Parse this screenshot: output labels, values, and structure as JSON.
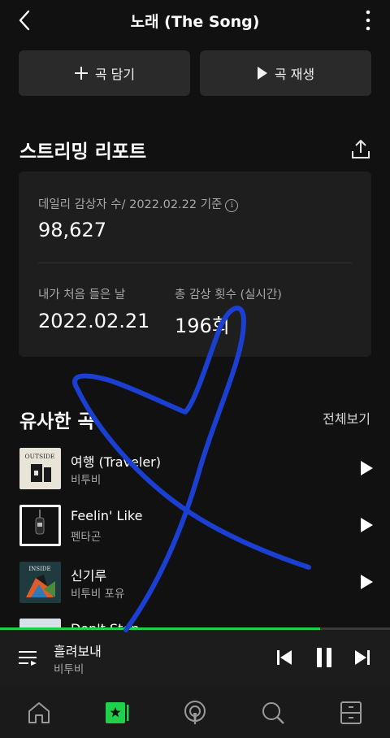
{
  "header": {
    "title": "노래 (The Song)"
  },
  "actions": {
    "add_label": "곡 담기",
    "play_label": "곡 재생"
  },
  "report": {
    "title": "스트리밍 리포트",
    "daily_listeners_label": "데일리 감상자 수/ 2022.02.22 기준",
    "daily_listeners_value": "98,627",
    "first_listen_label": "내가 처음 들은 날",
    "first_listen_value": "2022.02.21",
    "total_plays_label": "총 감상 횟수 (실시간)",
    "total_plays_value": "196회"
  },
  "similar": {
    "title": "유사한 곡",
    "see_all": "전체보기",
    "songs": [
      {
        "title": "여행 (Traveler)",
        "artist": "비투비",
        "cover_text": "OUTSIDE"
      },
      {
        "title": "Feelin' Like",
        "artist": "펜타곤"
      },
      {
        "title": "신기루",
        "artist": "비투비 포유",
        "cover_text": "INSIDE"
      },
      {
        "title": "Don't Stop"
      }
    ]
  },
  "player": {
    "title": "흘려보내",
    "artist": "비투비",
    "progress": 0.82
  },
  "colors": {
    "accent": "#1ed04a",
    "doodle": "#1a3fd1",
    "card": "#1e1e1e",
    "background": "#111111"
  },
  "nav": [
    "home-icon",
    "library-icon",
    "podcast-icon",
    "search-icon",
    "storage-icon"
  ]
}
